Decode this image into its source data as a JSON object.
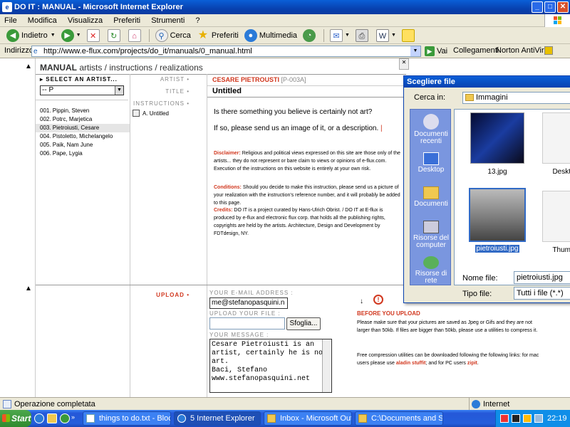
{
  "window": {
    "title": "DO IT : MANUAL - Microsoft Internet Explorer"
  },
  "menu": [
    "File",
    "Modifica",
    "Visualizza",
    "Preferiti",
    "Strumenti",
    "?"
  ],
  "toolbar": {
    "back": "Indietro",
    "search": "Cerca",
    "favorites": "Preferiti",
    "multimedia": "Multimedia"
  },
  "address": {
    "label": "Indirizzo",
    "url": "http://www.e-flux.com/projects/do_it/manuals/0_manual.html",
    "go": "Vai",
    "links": "Collegamenti",
    "antivirus": "Norton AntiVirus"
  },
  "site": {
    "heading_bold": "MANUAL",
    "heading_rest": "artists / instructions / realizations",
    "select_label": "▸ SELECT AN ARTIST...",
    "select_value": "-- P",
    "artists": [
      "001. Pippin, Steven",
      "002. Potrc, Marjetica",
      "003. Pietroiusti, Cesare",
      "004. Pistoletto, Michelangelo",
      "005. Paik, Nam June",
      "006. Pape, Lygia"
    ],
    "artist_label": "ARTIST",
    "artist_name": "CESARE PIETROUSTI",
    "artist_code": "[P-003A]",
    "title_label": "TITLE",
    "title_value": "Untitled",
    "instructions_label": "INSTRUCTIONS",
    "instruction_item": "A. Untitled",
    "question1": "Is there something you believe is certainly not art?",
    "question2": "If so, please send us an image of it, or a description.",
    "disclaimer_label": "Disclaimer:",
    "disclaimer_text": "Religious and political views expressed on this site are those only of the artists... they do not represent or bare claim to views or opinions of e-flux.com. Execution of the instructions on this website is entirely at your own risk.",
    "conditions_label": "Conditions:",
    "conditions_text": "Should you decide to make this instruction, please send us a picture of your realization with the instruction's reference number, and it will probably be added to this page.",
    "credits_label": "Credits:",
    "credits_text": "DO IT is a project curated by Hans-Ulrich Obrist. / DO IT at E-flux is produced by e-flux and electronic flux corp. that holds all the publishing rights, copyrights are held by the artists. Architecture, Design and Development by FDTdesign, NY.",
    "upload_label": "UPLOAD",
    "email_label": "YOUR E-MAIL ADDRESS :",
    "email_value": "me@stefanopasquini.n",
    "file_label": "UPLOAD YOUR FILE :",
    "browse": "Sfoglia...",
    "message_label": "YOUR MESSAGE :",
    "message_value": "Cesare Pietroiusti is an artist, certainly he is not art.\nBaci, Stefano\nwww.stefanopasquini.net",
    "before_title": "BEFORE YOU UPLOAD",
    "before_text1": "Please make sure that your pictures are saved as Jpeg or Gifs and they are not larger than 50kb. If files are bigger than 50kb, please use a utilities to compress it.",
    "before_text2a": "Free compression utilities can be downloaded following the following links: for mac users please use",
    "before_link1": "aladin stuffit",
    "before_text2b": "; and for PC users",
    "before_link2": "zipit"
  },
  "dialog": {
    "title": "Scegliere file",
    "lookin_label": "Cerca in:",
    "lookin_value": "Immagini",
    "places": [
      "Documenti recenti",
      "Desktop",
      "Documenti",
      "Risorse del computer",
      "Risorse di rete"
    ],
    "files": [
      "13.jpg",
      "Deskto",
      "pietroiusti.jpg",
      "Thumb"
    ],
    "filename_label": "Nome file:",
    "filename_value": "pietroiusti.jpg",
    "filetype_label": "Tipo file:",
    "filetype_value": "Tutti i file (*.*)"
  },
  "status": {
    "text": "Operazione completata",
    "zone": "Internet"
  },
  "taskbar": {
    "start": "Start",
    "tasks": [
      "things to do.txt - Blocco ...",
      "5 Internet Explorer",
      "Inbox - Microsoft Outlook",
      "C:\\Documents and Settin..."
    ],
    "clock": "22:19"
  }
}
